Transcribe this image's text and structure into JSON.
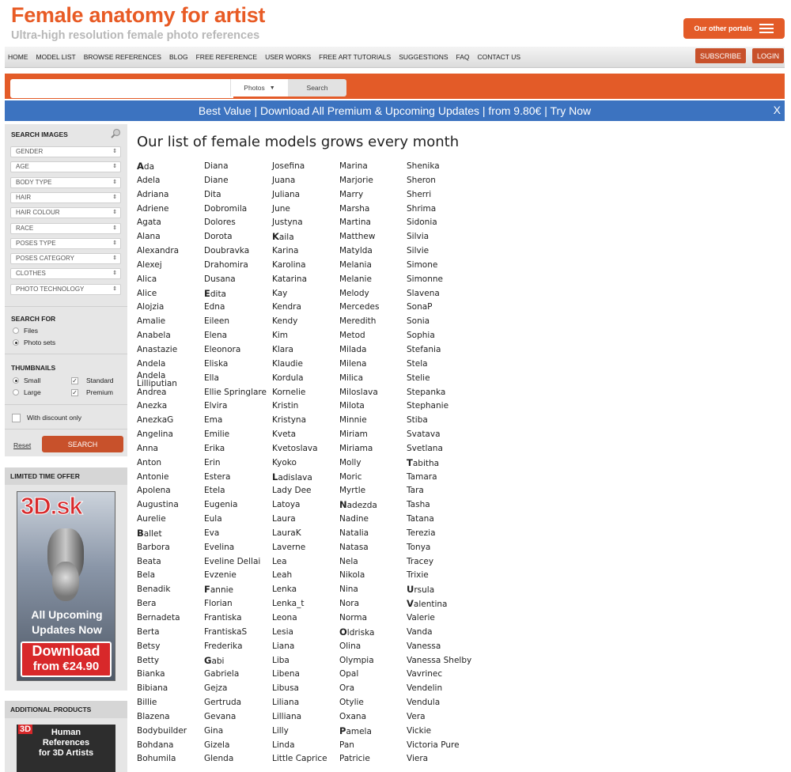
{
  "site": {
    "title": "Female anatomy for artist",
    "subtitle": "Ultra-high resolution female photo references",
    "portals_label": "Our other portals"
  },
  "nav": {
    "items": [
      "HOME",
      "MODEL LIST",
      "BROWSE REFERENCES",
      "BLOG",
      "FREE REFERENCE",
      "USER WORKS",
      "FREE ART TUTORIALS",
      "SUGGESTIONS",
      "FAQ",
      "CONTACT US"
    ],
    "subscribe": "SUBSCRIBE",
    "login": "LOGIN"
  },
  "search": {
    "placeholder": "",
    "type_selected": "Photos",
    "button": "Search"
  },
  "promo": {
    "text": "Best Value | Download All Premium & Upcoming Updates | from 9.80€ | Try Now",
    "close": "X"
  },
  "sidebar": {
    "search_images_title": "SEARCH IMAGES",
    "filters": [
      "GENDER",
      "AGE",
      "BODY TYPE",
      "HAIR",
      "HAIR COLOUR",
      "RACE",
      "POSES TYPE",
      "POSES CATEGORY",
      "CLOTHES",
      "PHOTO TECHNOLOGY"
    ],
    "search_for_title": "SEARCH FOR",
    "search_for": [
      {
        "label": "Files",
        "selected": false
      },
      {
        "label": "Photo sets",
        "selected": true
      }
    ],
    "thumbnails_title": "THUMBNAILS",
    "thumb_size": [
      {
        "label": "Small",
        "selected": true
      },
      {
        "label": "Large",
        "selected": false
      }
    ],
    "thumb_type": [
      {
        "label": "Standard",
        "checked": true
      },
      {
        "label": "Premium",
        "checked": true
      }
    ],
    "discount_label": "With discount only",
    "discount_checked": false,
    "reset": "Reset",
    "search_button": "SEARCH"
  },
  "offer": {
    "title": "LIMITED TIME OFFER",
    "logo": "3D.sk",
    "line1": "All Upcoming",
    "line2": "Updates Now",
    "download": "Download",
    "price": "from €24.90"
  },
  "additional": {
    "title": "ADDITIONAL PRODUCTS",
    "logo": "3D",
    "text1": "Human",
    "text2": "References",
    "text3": "for 3D Artists"
  },
  "main": {
    "title": "Our list of female models grows every month",
    "columns": [
      [
        "Ada",
        "Adela",
        "Adriana",
        "Adriene",
        "Agata",
        "Alana",
        "Alexandra",
        "Alexej",
        "Alica",
        "Alice",
        "Alojzia",
        "Amalie",
        "Anabela",
        "Anastazie",
        "Andela",
        "Andela Lilliputian",
        "Andrea",
        "Anezka",
        "AnezkaG",
        "Angelina",
        "Anna",
        "Anton",
        "Antonie",
        "Apolena",
        "Augustina",
        "Aurelie",
        "Ballet",
        "Barbora",
        "Beata",
        "Bela",
        "Benadik",
        "Bera",
        "Bernadeta",
        "Berta",
        "Betsy",
        "Betty",
        "Bianka",
        "Bibiana",
        "Billie",
        "Blazena",
        "Bodybuilder",
        "Bohdana",
        "Bohumila"
      ],
      [
        "Diana",
        "Diane",
        "Dita",
        "Dobromila",
        "Dolores",
        "Dorota",
        "Doubravka",
        "Drahomira",
        "Dusana",
        "Edita",
        "Edna",
        "Eileen",
        "Elena",
        "Eleonora",
        "Eliska",
        "Ella",
        "Ellie Springlare",
        "Elvira",
        "Ema",
        "Emilie",
        "Erika",
        "Erin",
        "Estera",
        "Etela",
        "Eugenia",
        "Eula",
        "Eva",
        "Evelina",
        "Eveline Dellai",
        "Evzenie",
        "Fannie",
        "Florian",
        "Frantiska",
        "FrantiskaS",
        "Frederika",
        "Gabi",
        "Gabriela",
        "Gejza",
        "Gertruda",
        "Gevana",
        "Gina",
        "Gizela",
        "Glenda"
      ],
      [
        "Josefina",
        "Juana",
        "Juliana",
        "June",
        "Justyna",
        "Kaila",
        "Karina",
        "Karolina",
        "Katarina",
        "Kay",
        "Kendra",
        "Kendy",
        "Kim",
        "Klara",
        "Klaudie",
        "Kordula",
        "Kornelie",
        "Kristin",
        "Kristyna",
        "Kveta",
        "Kvetoslava",
        "Kyoko",
        "Ladislava",
        "Lady Dee",
        "Latoya",
        "Laura",
        "LauraK",
        "Laverne",
        "Lea",
        "Leah",
        "Lenka",
        "Lenka_t",
        "Leona",
        "Lesia",
        "Liana",
        "Liba",
        "Libena",
        "Libusa",
        "Liliana",
        "Lilliana",
        "Lilly",
        "Linda",
        "Little Caprice"
      ],
      [
        "Marina",
        "Marjorie",
        "Marry",
        "Marsha",
        "Martina",
        "Matthew",
        "Matylda",
        "Melania",
        "Melanie",
        "Melody",
        "Mercedes",
        "Meredith",
        "Metod",
        "Milada",
        "Milena",
        "Milica",
        "Miloslava",
        "Milota",
        "Minnie",
        "Miriam",
        "Miriama",
        "Molly",
        "Moric",
        "Myrtle",
        "Nadezda",
        "Nadine",
        "Natalia",
        "Natasa",
        "Nela",
        "Nikola",
        "Nina",
        "Nora",
        "Norma",
        "Oldriska",
        "Olina",
        "Olympia",
        "Opal",
        "Ora",
        "Otylie",
        "Oxana",
        "Pamela",
        "Pan",
        "Patricie"
      ],
      [
        "Shenika",
        "Sheron",
        "Sherri",
        "Shrima",
        "Sidonia",
        "Silvia",
        "Silvie",
        "Simone",
        "Simonne",
        "Slavena",
        "SonaP",
        "Sonia",
        "Sophia",
        "Stefania",
        "Stela",
        "Stelie",
        "Stepanka",
        "Stephanie",
        "Stiba",
        "Svatava",
        "Svetlana",
        "Tabitha",
        "Tamara",
        "Tara",
        "Tasha",
        "Tatana",
        "Terezia",
        "Tonya",
        "Tracey",
        "Trixie",
        "Ursula",
        "Valentina",
        "Valerie",
        "Vanda",
        "Vanessa",
        "Vanessa Shelby",
        "Vavrinec",
        "Vendelin",
        "Vendula",
        "Vera",
        "Vickie",
        "Victoria Pure",
        "Viera"
      ]
    ],
    "initials": [
      "Ada",
      "Ballet",
      "Edita",
      "Fannie",
      "Gabi",
      "Kaila",
      "Ladislava",
      "Nadezda",
      "Oldriska",
      "Pamela",
      "Tabitha",
      "Ursula",
      "Valentina"
    ]
  }
}
